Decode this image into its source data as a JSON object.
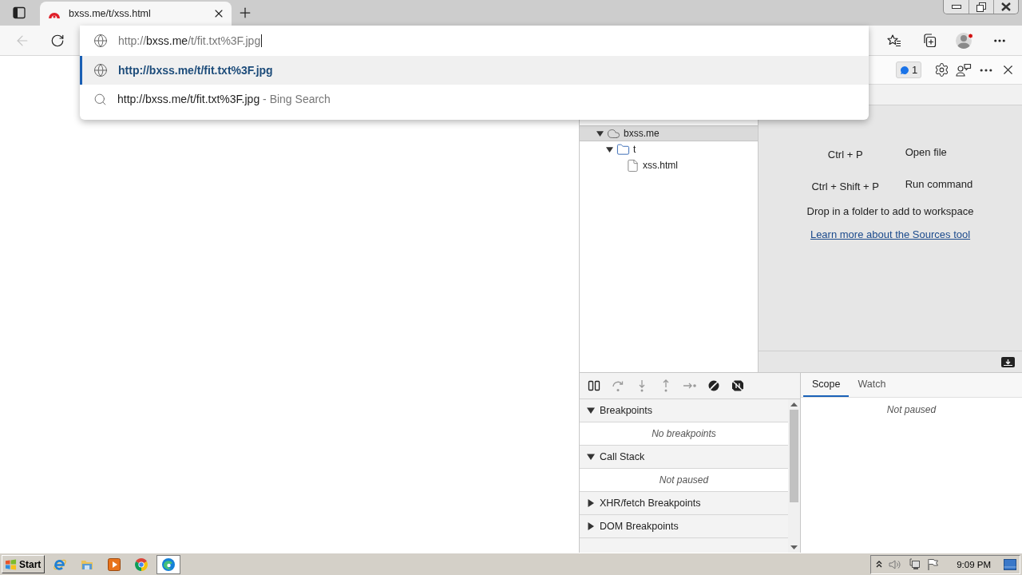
{
  "browser": {
    "tabs": [
      {
        "title": "bxss.me/t/xss.html",
        "selected": true
      }
    ],
    "back": {
      "disabled": true
    },
    "address": {
      "prefix": "http://",
      "host": "bxss.me",
      "rest": "/t/fit.txt%3F.jpg"
    },
    "suggestions": [
      {
        "kind": "url",
        "text": "http://bxss.me/t/fit.txt%3F.jpg",
        "selected": true
      },
      {
        "kind": "search",
        "text": "http://bxss.me/t/fit.txt%3F.jpg",
        "suffix": "- Bing Search",
        "selected": false
      }
    ]
  },
  "devtools": {
    "issues_count": "1",
    "navigator": [
      {
        "kind": "domain",
        "label": "bxss.me",
        "expanded": true,
        "selected": true,
        "children": [
          {
            "kind": "folder",
            "label": "t",
            "expanded": true,
            "selected": false,
            "children": [
              {
                "kind": "file",
                "label": "xss.html",
                "selected": false
              }
            ]
          }
        ]
      }
    ],
    "shortcuts": [
      {
        "keys": "Ctrl + P",
        "action": "Open file"
      },
      {
        "keys": "Ctrl + Shift + P",
        "action": "Run command"
      }
    ],
    "drop_hint": "Drop in a folder to add to workspace",
    "learn_more_link": "Learn more about the Sources tool",
    "sections": [
      {
        "title": "Breakpoints",
        "expanded": true,
        "message": "No breakpoints"
      },
      {
        "title": "Call Stack",
        "expanded": true,
        "message": "Not paused"
      },
      {
        "title": "XHR/fetch Breakpoints",
        "expanded": false
      },
      {
        "title": "DOM Breakpoints",
        "expanded": false
      }
    ],
    "sidebar_tabs": [
      {
        "label": "Scope",
        "selected": true
      },
      {
        "label": "Watch",
        "selected": false
      }
    ],
    "scope_message": "Not paused"
  },
  "taskbar": {
    "start_label": "Start",
    "apps": [
      {
        "kind": "ie",
        "selected": false
      },
      {
        "kind": "explorer",
        "selected": false
      },
      {
        "kind": "media",
        "selected": false
      },
      {
        "kind": "chrome",
        "selected": false
      },
      {
        "kind": "edge",
        "selected": true
      }
    ],
    "clock": "9:09 PM"
  }
}
